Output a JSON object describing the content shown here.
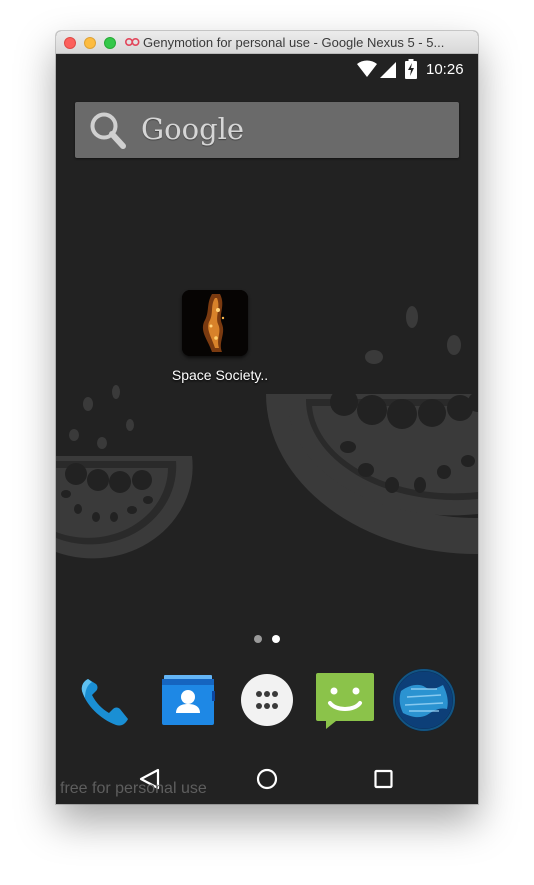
{
  "window": {
    "title": "Genymotion for personal use - Google Nexus 5 - 5..."
  },
  "statusbar": {
    "time": "10:26",
    "icons": [
      "wifi-icon",
      "cellular-signal-icon",
      "battery-charging-icon"
    ]
  },
  "search": {
    "label": "Google"
  },
  "home": {
    "app_label": "Space Society..",
    "page_count": 2,
    "current_page": 2
  },
  "dock": {
    "items": [
      "phone-icon",
      "contacts-icon",
      "app-drawer-icon",
      "messaging-icon",
      "browser-icon"
    ]
  },
  "navbar": {
    "buttons": [
      "back-icon",
      "home-icon",
      "recents-icon"
    ]
  },
  "watermark": {
    "text": "free for personal use"
  },
  "colors": {
    "screen_background": "#222222",
    "search_bar": "#6a6a6a",
    "wallpaper_shape": "#3a3a3a"
  }
}
